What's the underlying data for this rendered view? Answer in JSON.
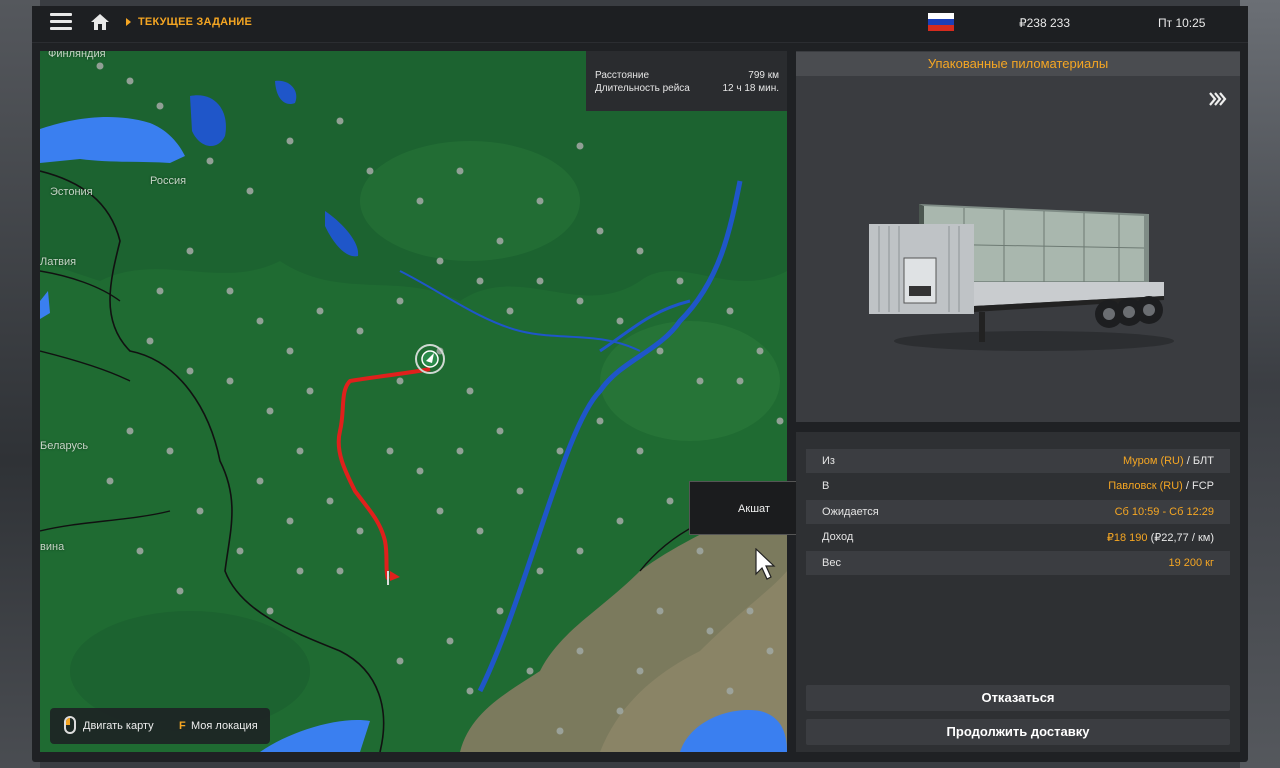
{
  "topbar": {
    "breadcrumb": "ТЕКУЩЕЕ ЗАДАНИЕ",
    "money": "₽238 233",
    "clock": "Пт 10:25"
  },
  "map": {
    "labels": {
      "finland": "Финляндия",
      "estonia": "Эстония",
      "russia": "Россия",
      "latvia": "Латвия",
      "belarus": "Беларусь",
      "lithuania": "вина"
    },
    "route_info": {
      "distance_label": "Расстояние",
      "distance_value": "799 км",
      "duration_label": "Длительность рейса",
      "duration_value": "12 ч 18 мин."
    },
    "legend": {
      "move_map": "Двигать карту",
      "location_key": "F",
      "location_label": "Моя локация"
    },
    "tooltip": "Акшат",
    "colors": {
      "land": "#1f6b32",
      "water": "#2f6fd8",
      "route": "#e0201c"
    }
  },
  "cargo": {
    "title": "Упакованные пиломатериалы",
    "fast_forward_icon": "fast-forward-icon"
  },
  "details": {
    "from_label": "Из",
    "from_city": "Муром (RU)",
    "from_company": " / БЛТ",
    "to_label": "В",
    "to_city": "Павловск (RU)",
    "to_company": " / FCP",
    "expected_label": "Ожидается",
    "expected_value": "Сб 10:59 - Сб 12:29",
    "income_label": "Доход",
    "income_value": "₽18 190",
    "income_rate": " (₽22,77 / км)",
    "weight_label": "Вес",
    "weight_value": "19 200 кг"
  },
  "buttons": {
    "decline": "Отказаться",
    "continue": "Продолжить доставку"
  },
  "accent": "#f5a623"
}
